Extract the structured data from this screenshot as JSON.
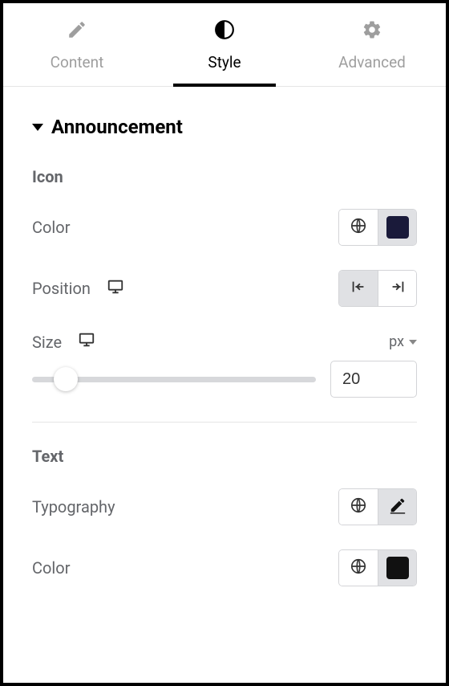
{
  "tabs": [
    {
      "label": "Content"
    },
    {
      "label": "Style"
    },
    {
      "label": "Advanced"
    }
  ],
  "section": {
    "title": "Announcement"
  },
  "icon": {
    "group_label": "Icon",
    "color_label": "Color",
    "color_value": "#1a1a3a",
    "position_label": "Position",
    "size_label": "Size",
    "size_unit": "px",
    "size_value": "20"
  },
  "text": {
    "group_label": "Text",
    "typography_label": "Typography",
    "color_label": "Color",
    "color_value": "#111111"
  }
}
